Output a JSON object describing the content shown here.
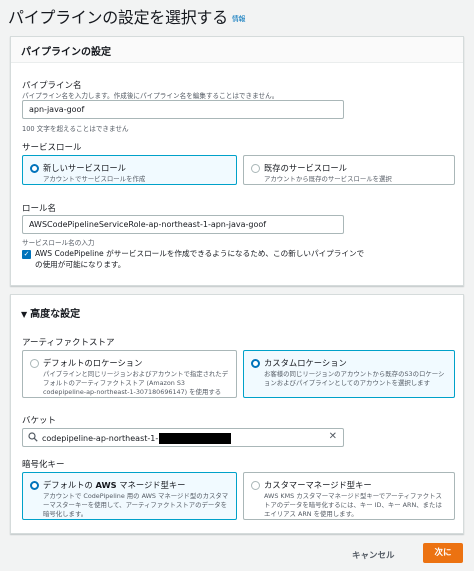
{
  "page": {
    "title": "パイプラインの設定を選択する",
    "info_link": "情報"
  },
  "pipeline_settings": {
    "header": "パイプラインの設定",
    "name_label": "パイプライン名",
    "name_desc": "パイプライン名を入力します。作成後にパイプライン名を編集することはできません。",
    "name_value": "apn-java-goof",
    "name_constraint": "100 文字を超えることはできません",
    "service_role_label": "サービスロール",
    "new_role": {
      "title": "新しいサービスロール",
      "desc": "アカウントでサービスロールを作成"
    },
    "existing_role": {
      "title": "既存のサービスロール",
      "desc": "アカウントから既存のサービスロールを選択"
    },
    "role_name_label": "ロール名",
    "role_name_value": "AWSCodePipelineServiceRole-ap-northeast-1-apn-java-goof",
    "role_name_hint": "サービスロール名の入力",
    "allow_checkbox_text": "AWS CodePipeline がサービスロールを作成できるようになるため、この新しいパイプラインでの使用が可能になります。"
  },
  "advanced": {
    "header": "高度な設定",
    "artifact_store_label": "アーティファクトストア",
    "default_location": {
      "title": "デフォルトのロケーション",
      "desc": "パイプラインと同じリージョンおよびアカウントで指定されたデフォルトのアーティファクトストア (Amazon S3 codepipeline-ap-northeast-1-307180696147) を使用する"
    },
    "custom_location": {
      "title": "カスタムロケーション",
      "desc": "お客様の同じリージョンのアカウントから既存のS3のロケーションおよびパイプラインとしてのアカウントを選択します"
    },
    "bucket_label": "バケット",
    "bucket_value": "codepipeline-ap-northeast-1-",
    "encryption_label": "暗号化キー",
    "default_key": {
      "title_prefix": "デフォルトの",
      "title_bold": "AWS",
      "title_suffix": "マネージド型キー",
      "desc": "アカウントで CodePipeline 用の AWS マネージド型のカスタマーマスターキーを使用して、アーティファクトストアのデータを暗号化します。"
    },
    "customer_key": {
      "title": "カスタマーマネージド型キー",
      "desc": "AWS KMS カスタマーマネージド型キーでアーティファクトストアのデータを暗号化するには、キー ID、キー ARN、またはエイリアス ARN を使用します。"
    }
  },
  "footer": {
    "cancel_label": "キャンセル",
    "next_label": "次に"
  },
  "colors": {
    "accent": "#0073bb",
    "selected_border": "#00a1c9",
    "primary_button": "#ec7211"
  }
}
